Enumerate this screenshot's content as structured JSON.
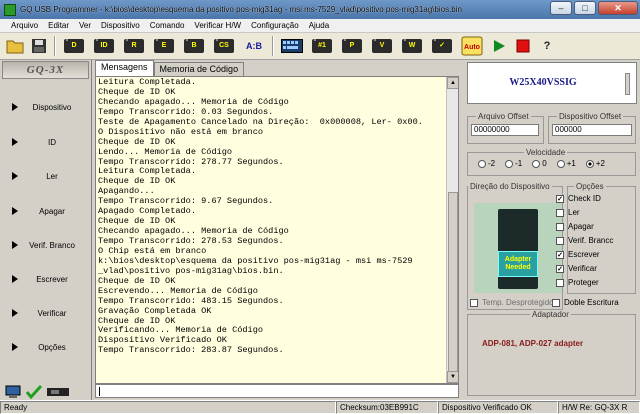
{
  "window": {
    "title": "GQ USB Programmer - k:\\bios\\desktop\\esquema da positivo pos-mig31ag - msi ms-7529_vlad\\positivo pos-mig31ag\\bios.bin",
    "minimize": "–",
    "maximize": "□",
    "close": "✕"
  },
  "menu": [
    "Arquivo",
    "Editar",
    "Ver",
    "Dispositivo",
    "Comando",
    "Verificar H/W",
    "Configuração",
    "Ajuda"
  ],
  "toolbar": {
    "compare_label": "A:B",
    "auto_label": "Auto"
  },
  "logo": "GQ-3X",
  "nav": [
    "Dispositivo",
    "ID",
    "Ler",
    "Apagar",
    "Verif. Branco",
    "Escrever",
    "Verificar",
    "Opções"
  ],
  "tabs": {
    "messages": "Mensagens",
    "memory": "Memoria de Código"
  },
  "log": [
    "Leitura Completada.",
    "Cheque de ID OK",
    "Checando apagado... Memoria de Código",
    "Tempo Transcorrido: 0.03 Segundos.",
    "Teste de Apagamento Cancelado na Direção:  0x000008, Ler- 0x00.",
    "O Dispositivo não está em branco",
    "Cheque de ID OK",
    "Lendo... Memoria de Código",
    "Tempo Transcorrido: 278.77 Segundos.",
    "Leitura Completada.",
    "Cheque de ID OK",
    "Apagando...",
    "Tempo Transcorrido: 9.67 Segundos.",
    "Apagado Completado.",
    "Cheque de ID OK",
    "Checando apagado... Memoria de Código",
    "Tempo Transcorrido: 278.53 Segundos.",
    "O Chip está em branco",
    "k:\\bios\\desktop\\esquema da positivo pos-mig31ag - msi ms-7529",
    "_vlad\\positivo pos-mig31ag\\bios.bin.",
    "Cheque de ID OK",
    "Escrevendo... Memoria de Código",
    "Tempo Transcorrido: 483.15 Segundos.",
    "Gravação Completada OK",
    "Cheque de ID OK",
    "Verificando... Memoria de Código",
    "Dispositivo Verificado OK",
    "Tempo Transcorrido: 283.87 Segundos."
  ],
  "device": {
    "name": "W25X40VSSIG"
  },
  "offsets": {
    "file_label": "Arquivo Offset",
    "file_value": "00000000",
    "device_label": "Dispositivo Offset",
    "device_value": "000000"
  },
  "speed": {
    "label": "Velocidade",
    "options": [
      "-2",
      "-1",
      "0",
      "+1",
      "+2"
    ],
    "selected": "+2"
  },
  "direction": {
    "label": "Direção do Dispositivo",
    "adapter_text_1": "Adapter",
    "adapter_text_2": "Needed",
    "temp_label": "Temp. Desprotegido"
  },
  "options": {
    "label": "Opções",
    "items": [
      {
        "label": "Check ID",
        "checked": true,
        "enabled": true
      },
      {
        "label": "Ler",
        "checked": false,
        "enabled": true
      },
      {
        "label": "Apagar",
        "checked": false,
        "enabled": true
      },
      {
        "label": "Verif. Brancc",
        "checked": false,
        "enabled": true
      },
      {
        "label": "Escrever",
        "checked": true,
        "enabled": true
      },
      {
        "label": "Verificar",
        "checked": true,
        "enabled": true
      },
      {
        "label": "Proteger",
        "checked": false,
        "enabled": true
      }
    ],
    "double_write": "Doble Escritura"
  },
  "adapter": {
    "label": "Adaptador",
    "text": "ADP-081, ADP-027 adapter"
  },
  "status": {
    "ready": "Ready",
    "checksum": "Checksum:03EB991C",
    "result": "Dispositivo Verificado OK",
    "hw": "H/W Re: GQ-3X R"
  },
  "colors": {
    "log_bg": "#ffffe0",
    "device_name": "#1a1a8a",
    "adapter_text": "#8a1a1a"
  }
}
